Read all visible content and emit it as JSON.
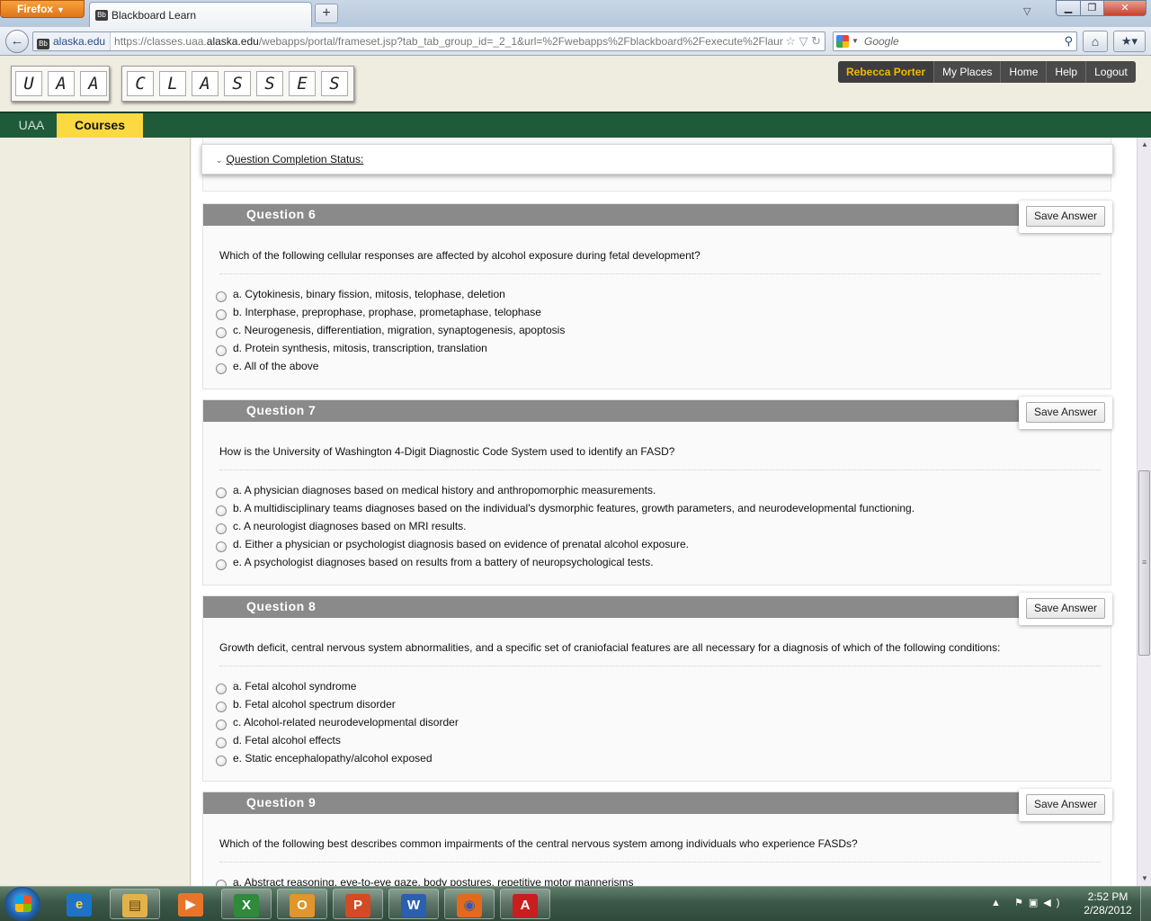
{
  "browser": {
    "app_button": "Firefox",
    "tab_title": "Blackboard Learn",
    "tab_favicon": "Bb",
    "site_identity": "alaska.edu",
    "url_prefix": "https://classes.uaa.",
    "url_domain": "alaska.edu",
    "url_suffix": "/webapps/portal/frameset.jsp?tab_tab_group_id=_2_1&url=%2Fwebapps%2Fblackboard%2Fexecute%2Flaun",
    "search_placeholder": "Google"
  },
  "header": {
    "logo_uaa": [
      "U",
      "A",
      "A"
    ],
    "logo_classes": [
      "C",
      "L",
      "A",
      "S",
      "S",
      "E",
      "S"
    ],
    "user_name": "Rebecca Porter",
    "nav": [
      "My Places",
      "Home",
      "Help",
      "Logout"
    ]
  },
  "tabs": {
    "uaa": "UAA",
    "courses": "Courses"
  },
  "status_panel": {
    "label": "Question Completion Status:"
  },
  "save_label": "Save Answer",
  "questions": [
    {
      "title": "Question 6",
      "text": "Which of the following cellular responses are affected by alcohol exposure during fetal development?",
      "choices": [
        "a. Cytokinesis, binary fission, mitosis, telophase, deletion",
        "b. Interphase, preprophase, prophase, prometaphase, telophase",
        "c. Neurogenesis, differentiation, migration, synaptogenesis, apoptosis",
        "d. Protein synthesis, mitosis, transcription, translation",
        "e. All of the above"
      ]
    },
    {
      "title": "Question 7",
      "text": "How is the University of Washington 4-Digit Diagnostic Code System used to identify an FASD?",
      "choices": [
        "a. A physician diagnoses based on medical history and anthropomorphic measurements.",
        "b. A multidisciplinary teams diagnoses based on the individual's dysmorphic features, growth parameters, and neurodevelopmental functioning.",
        "c. A neurologist diagnoses based on MRI results.",
        "d. Either a physician or psychologist diagnosis based on evidence of prenatal alcohol exposure.",
        "e. A psychologist diagnoses based on results from a battery of neuropsychological tests."
      ]
    },
    {
      "title": "Question 8",
      "text": "Growth deficit, central nervous system abnormalities, and a specific set of craniofacial features are all necessary for a diagnosis of which of the following conditions:",
      "choices": [
        "a. Fetal alcohol syndrome",
        "b. Fetal alcohol spectrum disorder",
        "c. Alcohol-related neurodevelopmental disorder",
        "d. Fetal alcohol effects",
        "e. Static encephalopathy/alcohol exposed"
      ]
    },
    {
      "title": "Question 9",
      "text": "Which of the following best describes common impairments of the central nervous system among individuals who experience FASDs?",
      "choices": [
        "a. Abstract reasoning, eye-to-eye gaze, body postures, repetitive motor mannerisms"
      ]
    }
  ],
  "taskbar": {
    "apps": [
      {
        "name": "internet-explorer",
        "glyph": "e"
      },
      {
        "name": "windows-explorer",
        "glyph": "▤"
      },
      {
        "name": "media-player",
        "glyph": "▶"
      },
      {
        "name": "excel",
        "glyph": "X"
      },
      {
        "name": "outlook",
        "glyph": "O"
      },
      {
        "name": "powerpoint",
        "glyph": "P"
      },
      {
        "name": "word",
        "glyph": "W"
      },
      {
        "name": "firefox",
        "glyph": "◉"
      },
      {
        "name": "acrobat",
        "glyph": "A"
      }
    ],
    "time": "2:52 PM",
    "date": "2/28/2012"
  }
}
